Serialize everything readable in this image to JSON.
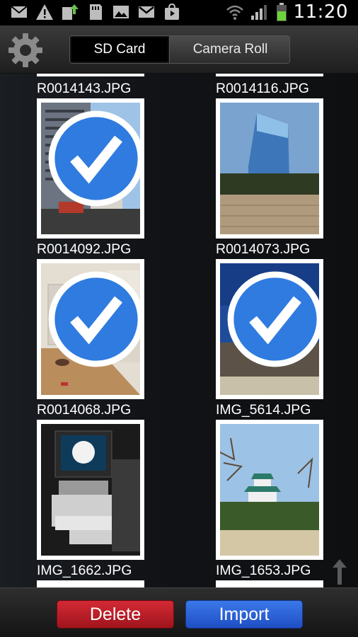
{
  "status_bar": {
    "time": "11:20",
    "icons": [
      "mail-icon",
      "warning-icon",
      "upload-icon",
      "sd-card-icon",
      "image-icon",
      "gmail-icon",
      "store-icon"
    ],
    "right_icons": [
      "wifi-icon",
      "signal-icon",
      "battery-icon"
    ]
  },
  "header": {
    "tabs": [
      {
        "label": "SD Card",
        "active": true
      },
      {
        "label": "Camera Roll",
        "active": false
      }
    ]
  },
  "grid": {
    "items": [
      {
        "filename": "R0014143.JPG",
        "checked": false
      },
      {
        "filename": "R0014116.JPG",
        "checked": false
      },
      {
        "filename": "R0014092.JPG",
        "checked": true
      },
      {
        "filename": "R0014073.JPG",
        "checked": false
      },
      {
        "filename": "R0014068.JPG",
        "checked": true
      },
      {
        "filename": "IMG_5614.JPG",
        "checked": true
      },
      {
        "filename": "IMG_1662.JPG",
        "checked": false
      },
      {
        "filename": "IMG_1653.JPG",
        "checked": false
      }
    ]
  },
  "footer": {
    "delete_label": "Delete",
    "import_label": "Import"
  },
  "colors": {
    "delete": "#c21f2a",
    "import": "#2d63d8",
    "check": "#2f7be0"
  }
}
